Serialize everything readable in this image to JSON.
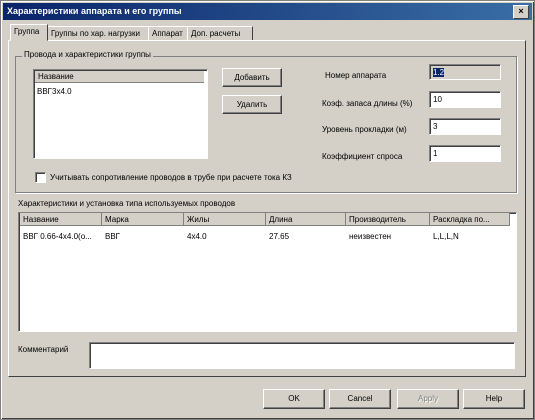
{
  "window": {
    "title": "Характеристики аппарата и его группы",
    "close_label": "×"
  },
  "tabs": [
    {
      "label": "Группа"
    },
    {
      "label": "Группы по хар. нагрузки"
    },
    {
      "label": "Аппарат"
    },
    {
      "label": "Доп. расчеты"
    }
  ],
  "group_section": {
    "legend": "Провода и характеристики группы",
    "list_header": "Название",
    "list_items": [
      "ВВГ3х4.0"
    ],
    "add_button": "Добавить",
    "delete_button": "Удалить"
  },
  "fields": {
    "apparatus_number": {
      "label": "Номер аппарата",
      "value": "1.2"
    },
    "reserve_coef": {
      "label": "Коэф. запаса длины (%)",
      "value": "10"
    },
    "laying_level": {
      "label": "Уровень прокладки (м)",
      "value": "3"
    },
    "demand_coef": {
      "label": "Коэффициент спроса",
      "value": "1"
    }
  },
  "checkbox": {
    "label": "Учитывать сопротивление проводов в трубе при расчете тока КЗ",
    "checked": false
  },
  "wires_table": {
    "caption": "Характеристики и установка типа используемых проводов",
    "columns": [
      "Название",
      "Марка",
      "Жилы",
      "Длина",
      "Производитель",
      "Раскладка по..."
    ],
    "rows": [
      [
        "ВВГ 0.66-4х4.0(о...",
        "ВВГ",
        "4х4.0",
        "27.65",
        "неизвестен",
        "L,L,L,N"
      ]
    ]
  },
  "comment": {
    "label": "Комментарий",
    "value": ""
  },
  "footer": {
    "ok": "OK",
    "cancel": "Cancel",
    "apply": "Apply",
    "help": "Help"
  }
}
